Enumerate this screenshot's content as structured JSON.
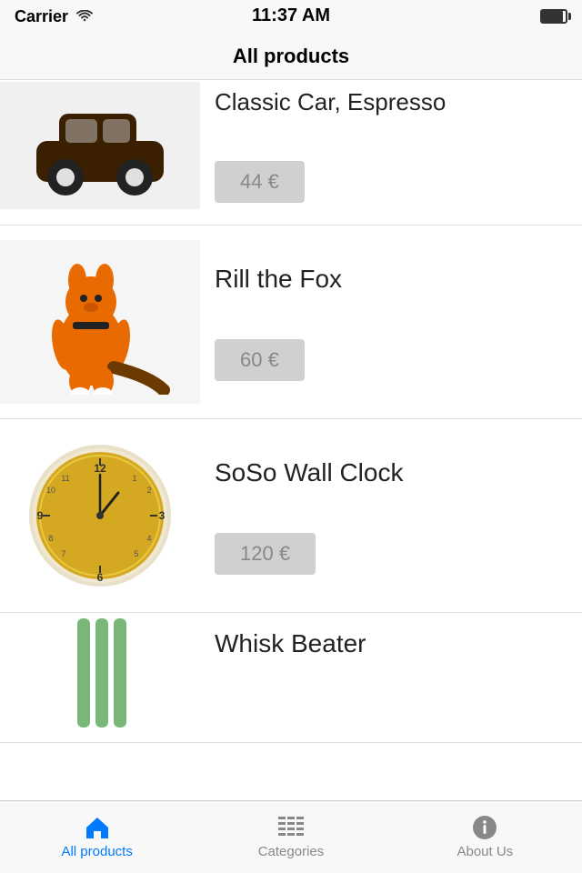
{
  "statusBar": {
    "carrier": "Carrier",
    "wifi": "wifi",
    "time": "11:37 AM",
    "battery": "full"
  },
  "navBar": {
    "title": "All products"
  },
  "products": [
    {
      "id": "classic-car",
      "name": "Classic Car, Espresso",
      "price": "44 €",
      "image": "car"
    },
    {
      "id": "rill-fox",
      "name": "Rill the Fox",
      "price": "60 €",
      "image": "fox"
    },
    {
      "id": "soso-clock",
      "name": "SoSo Wall Clock",
      "price": "120 €",
      "image": "clock"
    },
    {
      "id": "whisk-beater",
      "name": "Whisk Beater",
      "price": "",
      "image": "whisk"
    }
  ],
  "tabs": [
    {
      "id": "all-products",
      "label": "All products",
      "icon": "home",
      "active": true
    },
    {
      "id": "categories",
      "label": "Categories",
      "icon": "grid",
      "active": false
    },
    {
      "id": "about-us",
      "label": "About Us",
      "icon": "info",
      "active": false
    }
  ]
}
